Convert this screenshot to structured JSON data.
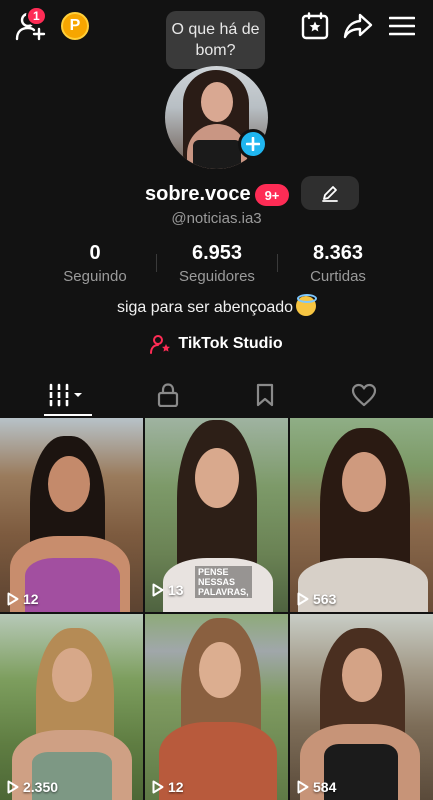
{
  "top_bar": {
    "notification_count": "1",
    "points_label": "P",
    "bubble_text": "O que há de bom?"
  },
  "profile": {
    "display_name": "sobre.voce",
    "inbox_badge": "9+",
    "username": "@noticias.ia3",
    "bio": "siga para ser abençoado",
    "studio_link": "TikTok Studio"
  },
  "stats": [
    {
      "value": "0",
      "label": "Seguindo"
    },
    {
      "value": "6.953",
      "label": "Seguidores"
    },
    {
      "value": "8.363",
      "label": "Curtidas"
    }
  ],
  "tabs": [
    {
      "icon": "videos-grid-icon",
      "active": true
    },
    {
      "icon": "lock-icon",
      "active": false
    },
    {
      "icon": "bookmark-icon",
      "active": false
    },
    {
      "icon": "heart-icon",
      "active": false
    }
  ],
  "videos": [
    {
      "views": "12"
    },
    {
      "views": "13",
      "caption": "PENSE NESSAS PALAVRAS,"
    },
    {
      "views": "563"
    },
    {
      "views": "2.350"
    },
    {
      "views": "12"
    },
    {
      "views": "584"
    }
  ],
  "colors": {
    "background": "#121212",
    "accent_red": "#fe2c55",
    "plus_blue": "#20b6f0",
    "points_gold": "#f7a600"
  }
}
